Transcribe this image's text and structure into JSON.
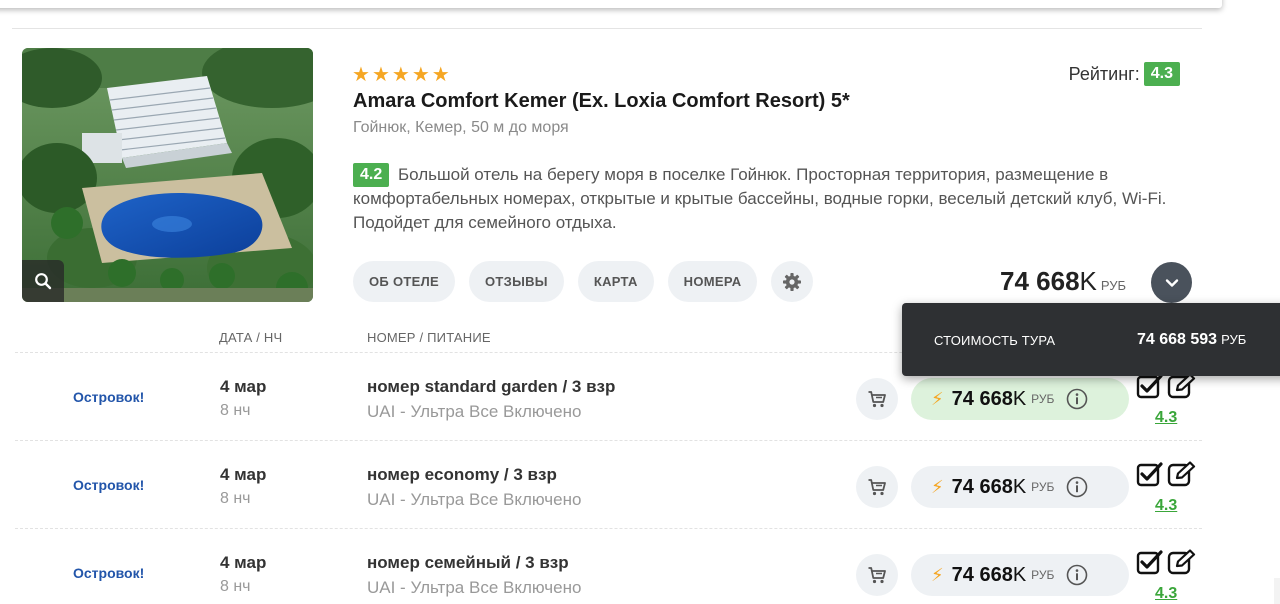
{
  "hotel": {
    "stars": 5,
    "name": "Amara Comfort Kemer (Ex. Loxia Comfort Resort) 5*",
    "location": "Гойнюк, Кемер, 50 м до моря",
    "rating_label": "Рейтинг:",
    "rating_value": "4.3",
    "review_score": "4.2",
    "description": "Большой отель на берегу моря в поселке Гойнюк. Просторная территория, размещение в комфортабельных номерах, открытые и крытые бассейны, водные горки, веселый детский клуб, Wi-Fi. Подойдет для семейного отдыха.",
    "tabs": [
      "ОБ ОТЕЛЕ",
      "ОТЗЫВЫ",
      "КАРТА",
      "НОМЕРА"
    ],
    "price_num": "74 668",
    "price_suffix": "K",
    "currency": "РУБ"
  },
  "table": {
    "col_date": "ДАТА / НЧ",
    "col_room": "НОМЕР / ПИТАНИЕ",
    "rows": [
      {
        "operator": "Островок!",
        "date": "4 мар",
        "nights": "8 нч",
        "room": "номер standard garden / 3 взр",
        "meal": "UAI - Ультра Все Включено",
        "price_num": "74 668",
        "price_suffix": "K",
        "currency": "РУБ",
        "rating": "4.3"
      },
      {
        "operator": "Островок!",
        "date": "4 мар",
        "nights": "8 нч",
        "room": "номер economy / 3 взр",
        "meal": "UAI - Ультра Все Включено",
        "price_num": "74 668",
        "price_suffix": "K",
        "currency": "РУБ",
        "rating": "4.3"
      },
      {
        "operator": "Островок!",
        "date": "4 мар",
        "nights": "8 нч",
        "room": "номер семейный / 3 взр",
        "meal": "UAI - Ультра Все Включено",
        "price_num": "74 668",
        "price_suffix": "K",
        "currency": "РУБ",
        "rating": "4.3"
      }
    ]
  },
  "tooltip": {
    "label": "СТОИМОСТЬ ТУРА",
    "value": "74 668 593",
    "currency": "РУБ"
  },
  "colors": {
    "star": "#f5a623",
    "badge_green": "#4caf50",
    "operator_blue": "#2255aa",
    "active_price_bg": "#ddf2dc",
    "tooltip_bg": "#2e3033"
  },
  "icons": [
    "search-icon",
    "gear-icon",
    "chevron-down-icon",
    "cart-icon",
    "lightning-icon",
    "info-icon",
    "checkbox-icon",
    "edit-icon",
    "star-icon"
  ]
}
